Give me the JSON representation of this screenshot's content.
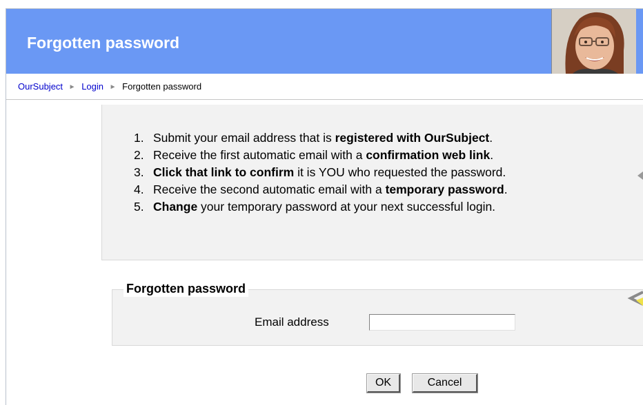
{
  "header": {
    "title": "Forgotten password",
    "photo_icon": "user-photo"
  },
  "breadcrumb": {
    "items": [
      {
        "label": "OurSubject",
        "link": true
      },
      {
        "label": "Login",
        "link": true
      },
      {
        "label": "Forgotten password",
        "link": false
      }
    ],
    "separator": "►"
  },
  "instructions": [
    {
      "num": "1.",
      "parts": [
        [
          "Submit your email address that is ",
          false
        ],
        [
          "registered with OurSubject",
          true
        ],
        [
          ".",
          false
        ]
      ]
    },
    {
      "num": "2.",
      "parts": [
        [
          "Receive the first automatic email with a ",
          false
        ],
        [
          "confirmation web link",
          true
        ],
        [
          ".",
          false
        ]
      ]
    },
    {
      "num": "3.",
      "parts": [
        [
          "Click that link to confirm",
          true
        ],
        [
          " it is YOU who requested the password.",
          false
        ]
      ]
    },
    {
      "num": "4.",
      "parts": [
        [
          "Receive the second automatic email with a ",
          false
        ],
        [
          "temporary password",
          true
        ],
        [
          ".",
          false
        ]
      ]
    },
    {
      "num": "5.",
      "parts": [
        [
          "Change",
          true
        ],
        [
          " your temporary password at your next successful login.",
          false
        ]
      ]
    }
  ],
  "form": {
    "legend": "Forgotten password",
    "email_label": "Email address",
    "email_value": ""
  },
  "buttons": {
    "ok": "OK",
    "cancel": "Cancel"
  },
  "colors": {
    "header_bg": "#6a98f4",
    "link": "#0000cc",
    "panel_bg": "#f2f2f2"
  }
}
